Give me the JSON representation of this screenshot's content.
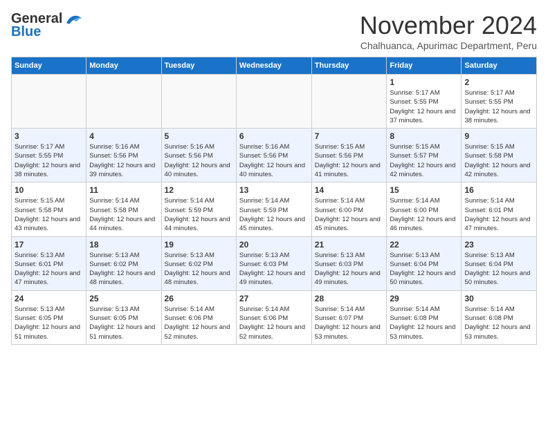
{
  "logo": {
    "part1": "General",
    "part2": "Blue"
  },
  "header": {
    "month": "November 2024",
    "location": "Chalhuanca, Apurimac Department, Peru"
  },
  "days_of_week": [
    "Sunday",
    "Monday",
    "Tuesday",
    "Wednesday",
    "Thursday",
    "Friday",
    "Saturday"
  ],
  "weeks": [
    [
      {
        "day": "",
        "info": ""
      },
      {
        "day": "",
        "info": ""
      },
      {
        "day": "",
        "info": ""
      },
      {
        "day": "",
        "info": ""
      },
      {
        "day": "",
        "info": ""
      },
      {
        "day": "1",
        "info": "Sunrise: 5:17 AM\nSunset: 5:55 PM\nDaylight: 12 hours and 37 minutes."
      },
      {
        "day": "2",
        "info": "Sunrise: 5:17 AM\nSunset: 5:55 PM\nDaylight: 12 hours and 38 minutes."
      }
    ],
    [
      {
        "day": "3",
        "info": "Sunrise: 5:17 AM\nSunset: 5:55 PM\nDaylight: 12 hours and 38 minutes."
      },
      {
        "day": "4",
        "info": "Sunrise: 5:16 AM\nSunset: 5:56 PM\nDaylight: 12 hours and 39 minutes."
      },
      {
        "day": "5",
        "info": "Sunrise: 5:16 AM\nSunset: 5:56 PM\nDaylight: 12 hours and 40 minutes."
      },
      {
        "day": "6",
        "info": "Sunrise: 5:16 AM\nSunset: 5:56 PM\nDaylight: 12 hours and 40 minutes."
      },
      {
        "day": "7",
        "info": "Sunrise: 5:15 AM\nSunset: 5:56 PM\nDaylight: 12 hours and 41 minutes."
      },
      {
        "day": "8",
        "info": "Sunrise: 5:15 AM\nSunset: 5:57 PM\nDaylight: 12 hours and 42 minutes."
      },
      {
        "day": "9",
        "info": "Sunrise: 5:15 AM\nSunset: 5:58 PM\nDaylight: 12 hours and 42 minutes."
      }
    ],
    [
      {
        "day": "10",
        "info": "Sunrise: 5:15 AM\nSunset: 5:58 PM\nDaylight: 12 hours and 43 minutes."
      },
      {
        "day": "11",
        "info": "Sunrise: 5:14 AM\nSunset: 5:58 PM\nDaylight: 12 hours and 44 minutes."
      },
      {
        "day": "12",
        "info": "Sunrise: 5:14 AM\nSunset: 5:59 PM\nDaylight: 12 hours and 44 minutes."
      },
      {
        "day": "13",
        "info": "Sunrise: 5:14 AM\nSunset: 5:59 PM\nDaylight: 12 hours and 45 minutes."
      },
      {
        "day": "14",
        "info": "Sunrise: 5:14 AM\nSunset: 6:00 PM\nDaylight: 12 hours and 45 minutes."
      },
      {
        "day": "15",
        "info": "Sunrise: 5:14 AM\nSunset: 6:00 PM\nDaylight: 12 hours and 46 minutes."
      },
      {
        "day": "16",
        "info": "Sunrise: 5:14 AM\nSunset: 6:01 PM\nDaylight: 12 hours and 47 minutes."
      }
    ],
    [
      {
        "day": "17",
        "info": "Sunrise: 5:13 AM\nSunset: 6:01 PM\nDaylight: 12 hours and 47 minutes."
      },
      {
        "day": "18",
        "info": "Sunrise: 5:13 AM\nSunset: 6:02 PM\nDaylight: 12 hours and 48 minutes."
      },
      {
        "day": "19",
        "info": "Sunrise: 5:13 AM\nSunset: 6:02 PM\nDaylight: 12 hours and 48 minutes."
      },
      {
        "day": "20",
        "info": "Sunrise: 5:13 AM\nSunset: 6:03 PM\nDaylight: 12 hours and 49 minutes."
      },
      {
        "day": "21",
        "info": "Sunrise: 5:13 AM\nSunset: 6:03 PM\nDaylight: 12 hours and 49 minutes."
      },
      {
        "day": "22",
        "info": "Sunrise: 5:13 AM\nSunset: 6:04 PM\nDaylight: 12 hours and 50 minutes."
      },
      {
        "day": "23",
        "info": "Sunrise: 5:13 AM\nSunset: 6:04 PM\nDaylight: 12 hours and 50 minutes."
      }
    ],
    [
      {
        "day": "24",
        "info": "Sunrise: 5:13 AM\nSunset: 6:05 PM\nDaylight: 12 hours and 51 minutes."
      },
      {
        "day": "25",
        "info": "Sunrise: 5:13 AM\nSunset: 6:05 PM\nDaylight: 12 hours and 51 minutes."
      },
      {
        "day": "26",
        "info": "Sunrise: 5:14 AM\nSunset: 6:06 PM\nDaylight: 12 hours and 52 minutes."
      },
      {
        "day": "27",
        "info": "Sunrise: 5:14 AM\nSunset: 6:06 PM\nDaylight: 12 hours and 52 minutes."
      },
      {
        "day": "28",
        "info": "Sunrise: 5:14 AM\nSunset: 6:07 PM\nDaylight: 12 hours and 53 minutes."
      },
      {
        "day": "29",
        "info": "Sunrise: 5:14 AM\nSunset: 6:08 PM\nDaylight: 12 hours and 53 minutes."
      },
      {
        "day": "30",
        "info": "Sunrise: 5:14 AM\nSunset: 6:08 PM\nDaylight: 12 hours and 53 minutes."
      }
    ]
  ]
}
